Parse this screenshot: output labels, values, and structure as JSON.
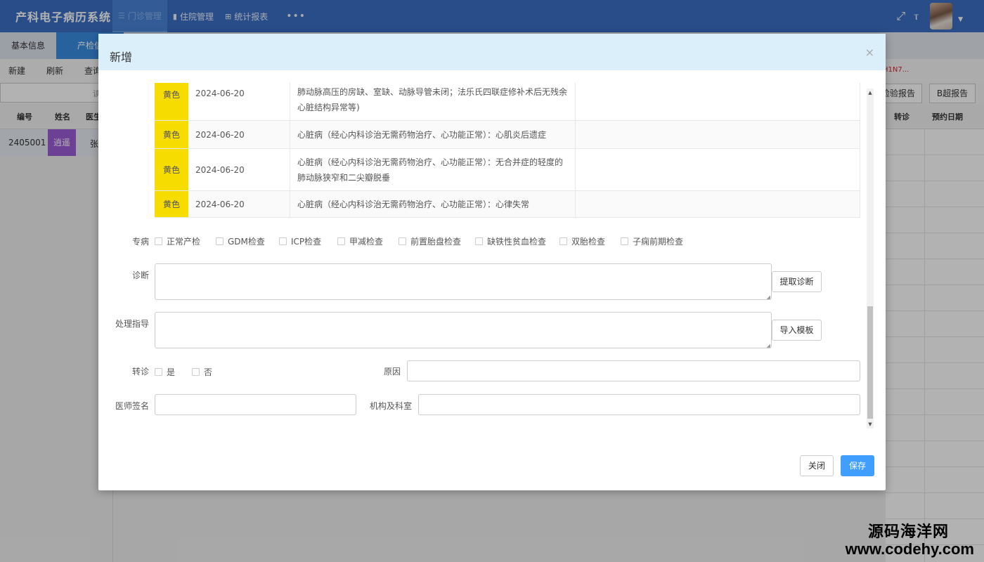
{
  "app": {
    "title": "产科电子病历系统",
    "nav": [
      {
        "label": "门诊管理",
        "icon": "list-icon"
      },
      {
        "label": "住院管理",
        "icon": "bar-chart-icon"
      },
      {
        "label": "统计报表",
        "icon": "grid-icon"
      }
    ],
    "more": "•••"
  },
  "background": {
    "subtabs": [
      "基本信息",
      "产检信"
    ],
    "toolbar": [
      "新建",
      "刷新",
      "查询"
    ],
    "red_note": "H1N7...",
    "search_suffix": "读",
    "right_buttons": [
      "检验报告",
      "B超报告"
    ],
    "headers": [
      "编号",
      "姓名",
      "医生",
      "转诊",
      "预约日期"
    ],
    "row": {
      "id": "2405001",
      "name": "逍遥",
      "doctor": "张"
    }
  },
  "modal": {
    "title": "新增",
    "close_icon": "×",
    "risk_rows": [
      {
        "color": "黄色",
        "date": "2024-06-20",
        "desc": "肺动脉高压的房缺、室缺、动脉导管未闭；法乐氏四联症修补术后无残余心脏结构异常等)"
      },
      {
        "color": "黄色",
        "date": "2024-06-20",
        "desc": "心脏病（经心内科诊治无需药物治疗、心功能正常）：心肌炎后遗症"
      },
      {
        "color": "黄色",
        "date": "2024-06-20",
        "desc": "心脏病（经心内科诊治无需药物治疗、心功能正常）：无合并症的轻度的肺动脉狭窄和二尖瓣脱垂"
      },
      {
        "color": "黄色",
        "date": "2024-06-20",
        "desc": "心脏病（经心内科诊治无需药物治疗、心功能正常）：心律失常"
      }
    ],
    "form": {
      "special_label": "专病",
      "special_options": [
        "正常产检",
        "GDM检查",
        "ICP检查",
        "甲减检查",
        "前置胎盘检查",
        "缺铁性贫血检查",
        "双胎检查",
        "子痫前期检查"
      ],
      "diagnosis_label": "诊断",
      "diagnosis_value": "",
      "extract_btn": "提取诊断",
      "guidance_label": "处理指导",
      "guidance_value": "",
      "import_btn": "导入模板",
      "referral_label": "转诊",
      "referral_yes": "是",
      "referral_no": "否",
      "reason_label": "原因",
      "reason_value": "",
      "doctor_label": "医师签名",
      "doctor_value": "",
      "org_label": "机构及科室",
      "org_value": ""
    },
    "footer": {
      "close": "关闭",
      "save": "保存"
    }
  },
  "watermark": {
    "line1": "源码海洋网",
    "line2": "www.codehy.com"
  }
}
